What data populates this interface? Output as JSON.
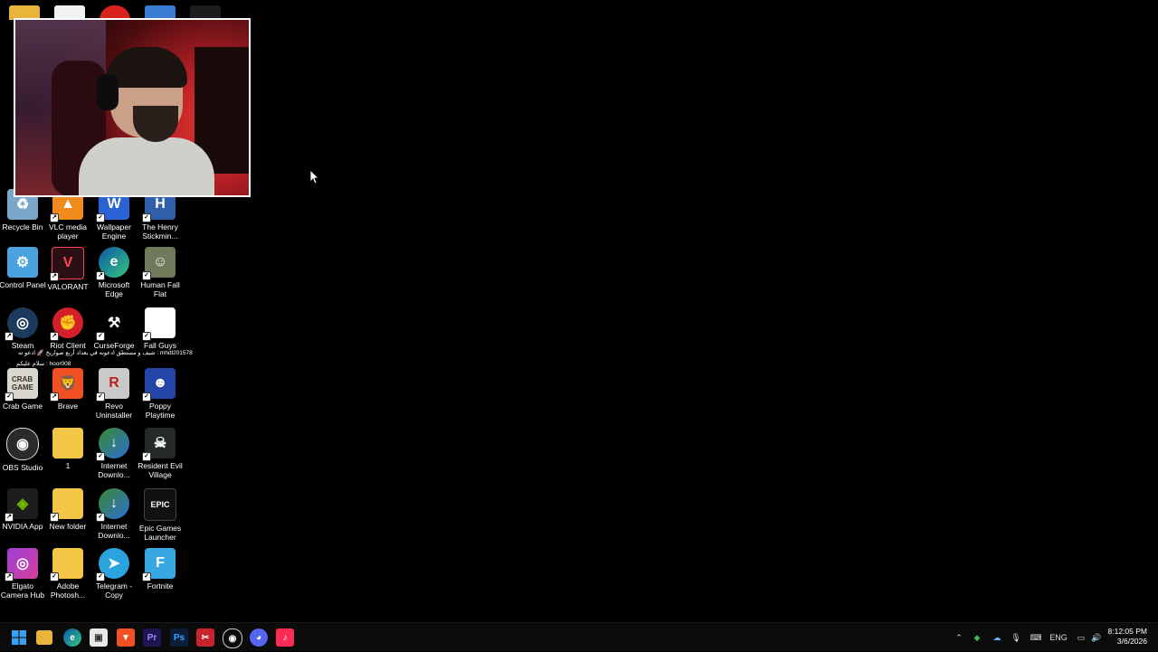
{
  "desktop": {
    "icons": [
      {
        "label": "Recycle Bin"
      },
      {
        "label": "VLC media player"
      },
      {
        "label": "Wallpaper Engine"
      },
      {
        "label": "The Henry Stickmin..."
      },
      {
        "label": "Control Panel"
      },
      {
        "label": "VALORANT"
      },
      {
        "label": "Microsoft Edge"
      },
      {
        "label": "Human Fall Flat"
      },
      {
        "label": "Steam"
      },
      {
        "label": "Riot Client"
      },
      {
        "label": "CurseForge"
      },
      {
        "label": "Fall Guys"
      },
      {
        "label": "Crab Game"
      },
      {
        "label": "Brave"
      },
      {
        "label": "Revo Uninstaller"
      },
      {
        "label": "Poppy Playtime"
      },
      {
        "label": "OBS Studio"
      },
      {
        "label": "1"
      },
      {
        "label": "Internet Downlo..."
      },
      {
        "label": "Resident Evil Village"
      },
      {
        "label": "NVIDIA App"
      },
      {
        "label": "New folder"
      },
      {
        "label": "Internet Downlo..."
      },
      {
        "label": "Epic Games Launcher"
      },
      {
        "label": "Elgato Camera Hub"
      },
      {
        "label": "Adobe Photosh..."
      },
      {
        "label": "Telegram - Copy"
      },
      {
        "label": "Fortnite"
      }
    ]
  },
  "overlay": {
    "chat_line_1": "شيف و مستطق ادعونه في بغداد أربع صواريخ 🚀 ادعو ته : mhdl201578",
    "chat_line_2": "سلام عليكم : hoor008"
  },
  "taskbar": {
    "apps": [
      "Start",
      "File Explorer",
      "Microsoft Edge",
      "Microsoft Store",
      "Brave",
      "Premiere Pro",
      "Photoshop",
      "Snipping Tool",
      "OBS Studio",
      "Discord",
      "TikTok LIVE Studio"
    ],
    "tray": {
      "language": "ENG",
      "time": "8:12:05 PM",
      "date": "3/6/2026"
    }
  }
}
